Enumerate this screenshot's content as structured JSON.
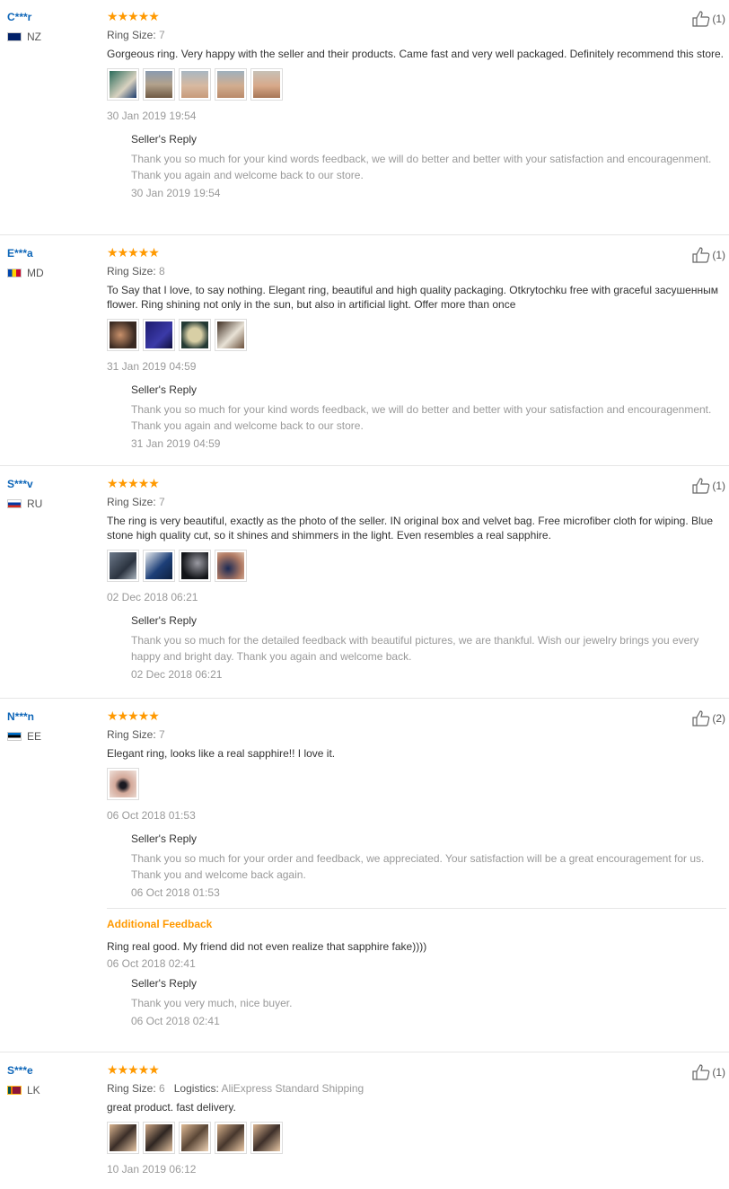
{
  "reviews": [
    {
      "user": "C***r",
      "country": "NZ",
      "rating": 5,
      "ring_size_label": "Ring Size:",
      "ring_size": "7",
      "text": "Gorgeous ring. Very happy with the seller and their products. Came fast and very well packaged. Definitely recommend this store.",
      "date": "30 Jan 2019 19:54",
      "helpful": "(1)",
      "photos": 5,
      "reply_title": "Seller's Reply",
      "reply_text": "Thank you so much for your kind words feedback, we will do better and better with your satisfaction and encouragenment. Thank you again and welcome back to our store.",
      "reply_date": "30 Jan 2019 19:54"
    },
    {
      "user": "E***a",
      "country": "MD",
      "rating": 5,
      "ring_size_label": "Ring Size:",
      "ring_size": "8",
      "text": "To Say that I love, to say nothing. Elegant ring, beautiful and high quality packaging. Otkrytochku free with graceful засушенным flower. Ring shining not only in the sun, but also in artificial light. Offer more than once",
      "date": "31 Jan 2019 04:59",
      "helpful": "(1)",
      "photos": 4,
      "reply_title": "Seller's Reply",
      "reply_text": "Thank you so much for your kind words feedback, we will do better and better with your satisfaction and encouragenment. Thank you again and welcome back to our store.",
      "reply_date": "31 Jan 2019 04:59"
    },
    {
      "user": "S***v",
      "country": "RU",
      "rating": 5,
      "ring_size_label": "Ring Size:",
      "ring_size": "7",
      "text": "The ring is very beautiful, exactly as the photo of the seller. IN original box and velvet bag. Free microfiber cloth for wiping. Blue stone high quality cut, so it shines and shimmers in the light. Even resembles a real sapphire.",
      "date": "02 Dec 2018 06:21",
      "helpful": "(1)",
      "photos": 4,
      "reply_title": "Seller's Reply",
      "reply_text": "Thank you so much for the detailed feedback with beautiful pictures, we are thankful. Wish our jewelry brings you every happy and bright day. Thank you again and welcome back.",
      "reply_date": "02 Dec 2018 06:21"
    },
    {
      "user": "N***n",
      "country": "EE",
      "rating": 5,
      "ring_size_label": "Ring Size:",
      "ring_size": "7",
      "text": "Elegant ring, looks like a real sapphire!! I love it.",
      "date": "06 Oct 2018 01:53",
      "helpful": "(2)",
      "photos": 1,
      "reply_title": "Seller's Reply",
      "reply_text": "Thank you so much for your order and feedback, we appreciated. Your satisfaction will be a great encouragement for us. Thank you and welcome back again.",
      "reply_date": "06 Oct 2018 01:53",
      "additional": {
        "title": "Additional Feedback",
        "text": "Ring real good. My friend did not even realize that sapphire fake))))",
        "date": "06 Oct 2018 02:41",
        "reply_title": "Seller's Reply",
        "reply_text": "Thank you very much, nice buyer.",
        "reply_date": "06 Oct 2018 02:41"
      }
    },
    {
      "user": "S***e",
      "country": "LK",
      "rating": 5,
      "ring_size_label": "Ring Size:",
      "ring_size": "6",
      "logistics_label": "Logistics:",
      "logistics": "AliExpress Standard Shipping",
      "text": "great product. fast delivery.",
      "date": "10 Jan 2019 06:12",
      "helpful": "(1)",
      "photos": 5
    }
  ],
  "colors": {
    "star": "#ff9900",
    "username": "#0e66b8",
    "accent": "#ff9900"
  },
  "icons": {
    "rating": "star-icon",
    "helpful": "thumbs-up-icon"
  }
}
